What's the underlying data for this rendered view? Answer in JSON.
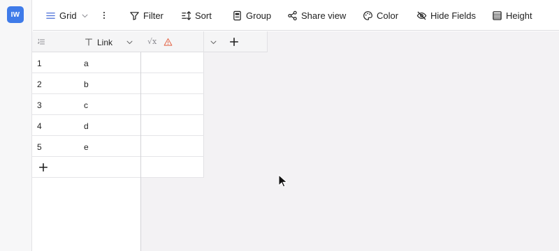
{
  "workspace": {
    "badge": "IW",
    "color": "#3f7be9"
  },
  "toolbar": {
    "view_label": "Grid",
    "filter_label": "Filter",
    "sort_label": "Sort",
    "group_label": "Group",
    "share_label": "Share view",
    "color_label": "Color",
    "hide_fields_label": "Hide Fields",
    "height_label": "Height"
  },
  "table": {
    "columns": [
      {
        "name": "Link",
        "type": "text"
      },
      {
        "name": "",
        "type": "formula",
        "warning": true
      }
    ],
    "rows": [
      {
        "index": "1",
        "link": "a"
      },
      {
        "index": "2",
        "link": "b"
      },
      {
        "index": "3",
        "link": "c"
      },
      {
        "index": "4",
        "link": "d"
      },
      {
        "index": "5",
        "link": "e"
      }
    ]
  },
  "icons": {
    "view": "grid-lines-icon",
    "more": "vertical-dots-icon",
    "filter": "funnel-icon",
    "sort": "sort-icon",
    "group": "group-icon",
    "share": "share-icon",
    "color": "palette-icon",
    "hide": "eye-off-icon",
    "height": "row-height-icon"
  }
}
